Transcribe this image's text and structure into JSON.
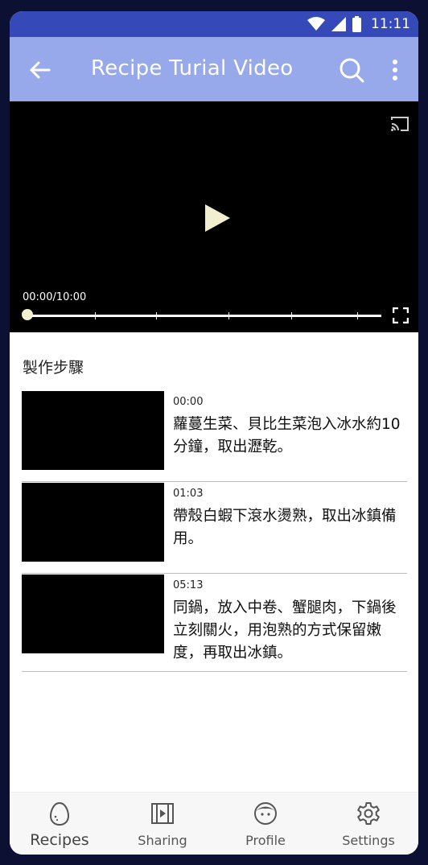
{
  "status_bar": {
    "time": "11:11"
  },
  "app_bar": {
    "title": "Recipe Turial Video"
  },
  "video": {
    "time_display": "00:00/10:00",
    "progress": 0
  },
  "steps_section": {
    "title": "製作步驟"
  },
  "steps": [
    {
      "timestamp": "00:00",
      "description": "蘿蔓生菜、貝比生菜泡入冰水約10分鐘，取出瀝乾。"
    },
    {
      "timestamp": "01:03",
      "description": "帶殼白蝦下滾水燙熟，取出冰鎮備用。"
    },
    {
      "timestamp": "05:13",
      "description": "同鍋，放入中卷、蟹腿肉，下鍋後立刻關火，用泡熟的方式保留嫩度，再取出冰鎮。"
    }
  ],
  "bottom_nav": [
    {
      "label": "Recipes",
      "icon": "egg-icon",
      "active": true
    },
    {
      "label": "Sharing",
      "icon": "video-icon",
      "active": false
    },
    {
      "label": "Profile",
      "icon": "face-icon",
      "active": false
    },
    {
      "label": "Settings",
      "icon": "gear-icon",
      "active": false
    }
  ],
  "colors": {
    "status_bar": "#3549b8",
    "app_bar": "#97a8eb",
    "frame": "#0c1033"
  }
}
